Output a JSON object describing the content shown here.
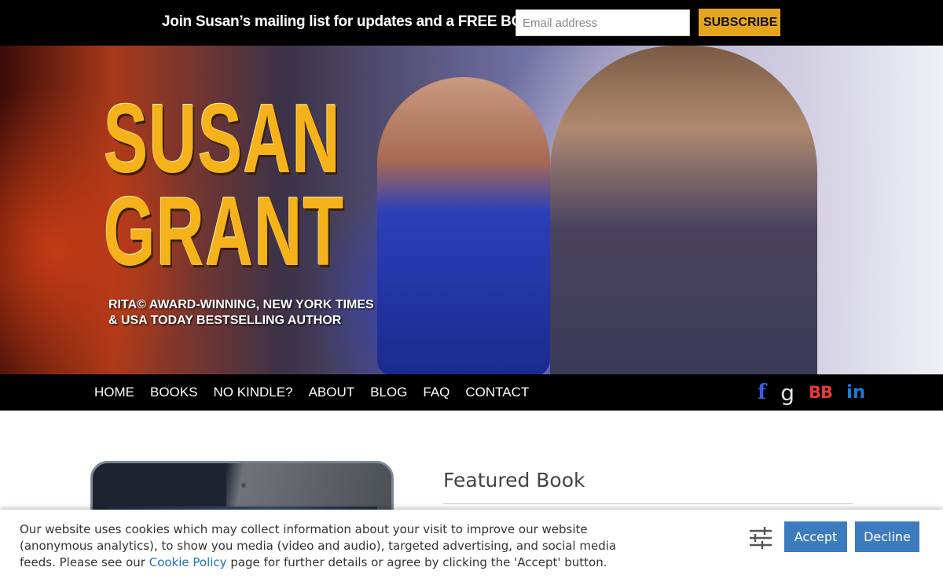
{
  "mailing": {
    "promo_text": "Join Susan’s mailing list for updates and a FREE BOOK!",
    "email_placeholder": "Email address",
    "subscribe_label": "SUBSCRIBE"
  },
  "hero": {
    "logo_line1": "SUSAN",
    "logo_line2": "GRANT",
    "tagline_line1": "RITA© AWARD-WINNING, NEW YORK TIMES",
    "tagline_line2": "& USA TODAY BESTSELLING AUTHOR"
  },
  "nav": {
    "items": [
      {
        "label": "HOME"
      },
      {
        "label": "BOOKS"
      },
      {
        "label": "NO KINDLE?"
      },
      {
        "label": "ABOUT"
      },
      {
        "label": "BLOG"
      },
      {
        "label": "FAQ"
      },
      {
        "label": "CONTACT"
      }
    ],
    "social": [
      {
        "icon": "facebook-icon",
        "glyph": "f"
      },
      {
        "icon": "goodreads-icon",
        "glyph": "g"
      },
      {
        "icon": "bookbub-icon",
        "glyph": "BB"
      },
      {
        "icon": "linkedin-icon",
        "glyph": "in"
      }
    ]
  },
  "featured": {
    "title": "Featured Book"
  },
  "cookie": {
    "text_before_link": "Our website uses cookies which may collect information about your visit to improve our website (anonymous analytics), to show you media (video and audio), targeted advertising, and social media feeds. Please see our ",
    "link_text": "Cookie Policy",
    "text_after_link": " page for further details or agree by clicking the 'Accept' button.",
    "accept_label": "Accept",
    "decline_label": "Decline"
  },
  "colors": {
    "subscribe_bg": "#e5a51c",
    "cookie_button_bg": "#3d7bbf",
    "link": "#1f6fb5",
    "facebook": "#3b5de0",
    "bookbub": "#e23b3b",
    "linkedin": "#1d7cd6"
  }
}
